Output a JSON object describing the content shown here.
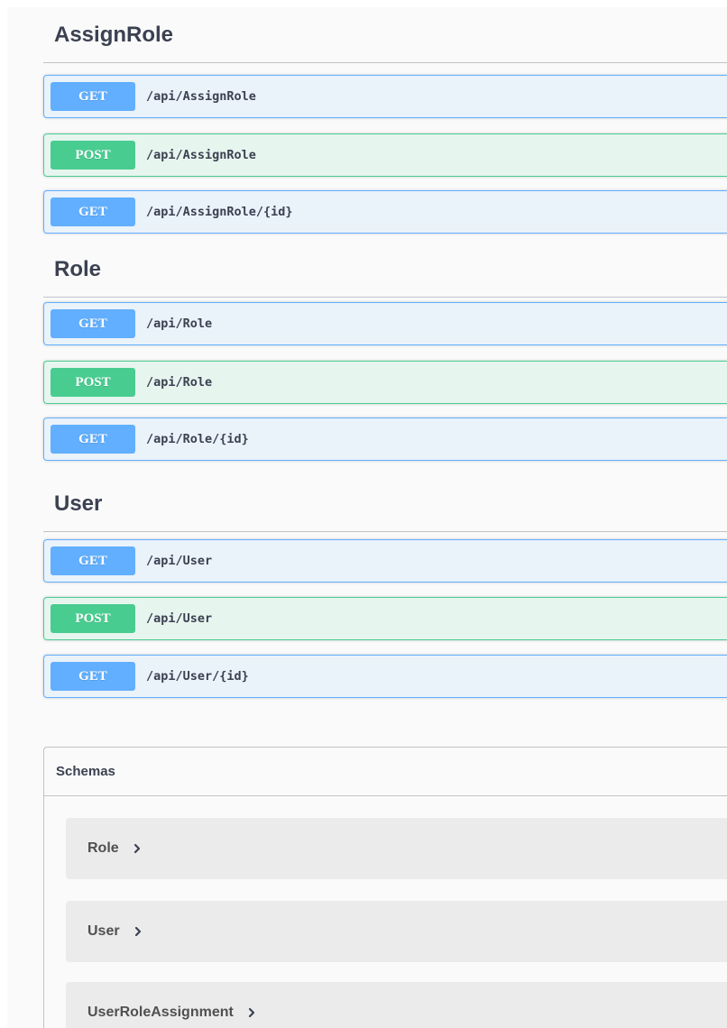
{
  "tags": [
    {
      "name": "AssignRole",
      "operations": [
        {
          "method": "GET",
          "path": "/api/AssignRole"
        },
        {
          "method": "POST",
          "path": "/api/AssignRole"
        },
        {
          "method": "GET",
          "path": "/api/AssignRole/{id}"
        }
      ]
    },
    {
      "name": "Role",
      "operations": [
        {
          "method": "GET",
          "path": "/api/Role"
        },
        {
          "method": "POST",
          "path": "/api/Role"
        },
        {
          "method": "GET",
          "path": "/api/Role/{id}"
        }
      ]
    },
    {
      "name": "User",
      "operations": [
        {
          "method": "GET",
          "path": "/api/User"
        },
        {
          "method": "POST",
          "path": "/api/User"
        },
        {
          "method": "GET",
          "path": "/api/User/{id}"
        }
      ]
    }
  ],
  "schemas": {
    "title": "Schemas",
    "models": [
      {
        "name": "Role",
        "icon": "chevron-right-icon"
      },
      {
        "name": "User",
        "icon": "chevron-right-icon"
      },
      {
        "name": "UserRoleAssignment",
        "icon": "chevron-right-icon"
      }
    ]
  },
  "colors": {
    "get": "#61affe",
    "post": "#49cc90",
    "text": "#3b4151"
  }
}
